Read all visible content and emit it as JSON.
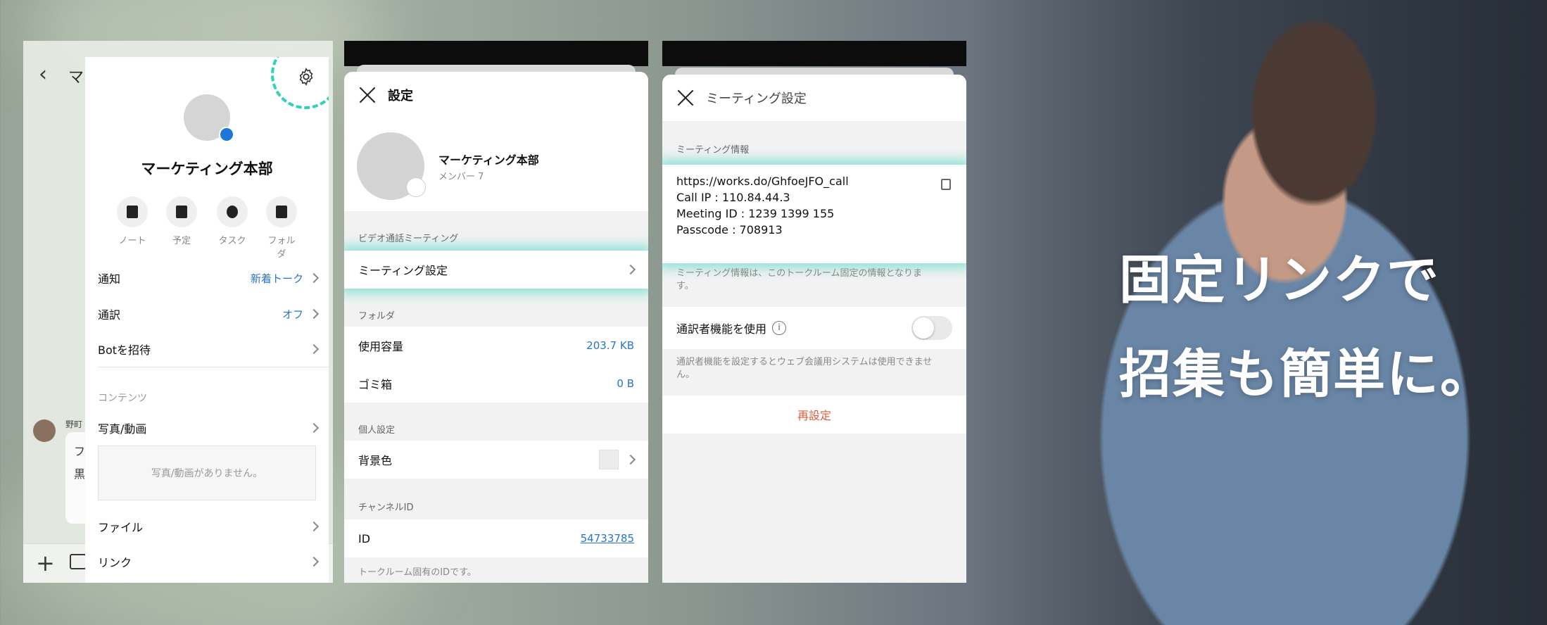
{
  "colors": {
    "accent": "#2ed2b9",
    "link": "#2a73c9",
    "danger": "#e05a3a"
  },
  "hero": {
    "line1": "固定リンクで",
    "line2": "招集も簡単に。"
  },
  "chat_background": {
    "title_fragment": "マー",
    "sender": "野町",
    "bubble_line1": "フ",
    "bubble_line2": "黒"
  },
  "group_panel": {
    "group_name": "マーケティング本部",
    "quick_actions": [
      {
        "label": "ノート",
        "icon": "note-icon"
      },
      {
        "label": "予定",
        "icon": "calendar-icon"
      },
      {
        "label": "タスク",
        "icon": "task-icon"
      },
      {
        "label": "フォルダ",
        "icon": "folder-icon"
      }
    ],
    "rows": [
      {
        "label": "通知",
        "value": "新着トーク"
      },
      {
        "label": "通訳",
        "value": "オフ"
      },
      {
        "label": "Botを招待",
        "value": ""
      }
    ],
    "contents_section": "コンテンツ",
    "photos_label": "写真/動画",
    "photos_empty": "写真/動画がありません。",
    "files_label": "ファイル",
    "links_label": "リンク"
  },
  "settings_panel": {
    "title": "設定",
    "group_name": "マーケティング本部",
    "members": "メンバー 7",
    "video_section": "ビデオ通話ミーティング",
    "meeting_settings": "ミーティング設定",
    "folder_section": "フォルダ",
    "usage_label": "使用容量",
    "usage_value": "203.7 KB",
    "trash_label": "ゴミ箱",
    "trash_value": "0 B",
    "personal_section": "個人設定",
    "bg_label": "背景色",
    "channel_section": "チャンネルID",
    "id_label": "ID",
    "id_value": "54733785",
    "id_note": "トークルーム固有のIDです。"
  },
  "meeting_panel": {
    "title": "ミーティング設定",
    "info_section": "ミーティング情報",
    "url": "https://works.do/GhfoeJFO_call",
    "call_ip": "Call IP : 110.84.44.3",
    "meeting_id": "Meeting ID : 1239 1399 155",
    "passcode": "Passcode : 708913",
    "info_note": "ミーティング情報は、このトークルーム固定の情報となります。",
    "interpreter_label": "通訳者機能を使用",
    "interpreter_on": false,
    "interpreter_note": "通訳者機能を設定するとウェブ会議用システムは使用できません。",
    "reset": "再設定"
  }
}
